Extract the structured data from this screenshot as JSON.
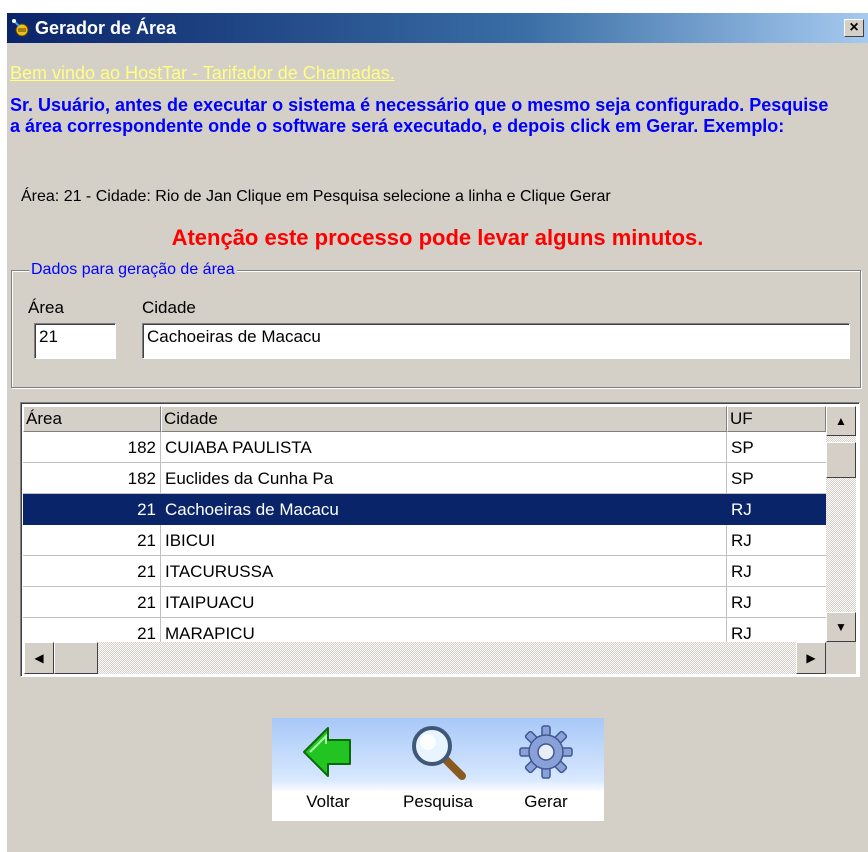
{
  "window": {
    "title": "Gerador de Área",
    "close_label": "×"
  },
  "welcome": "Bem vindo ao HostTar - Tarifador de Chamadas.",
  "instructions": "Sr. Usuário, antes de executar o sistema é necessário que o mesmo seja configurado. Pesquise a área correspondente onde o software será executado, e depois click em Gerar. Exemplo:",
  "example": "Área: 21 -  Cidade: Rio de Jan Clique em Pesquisa selecione a linha e Clique Gerar",
  "warning": "Atenção este processo pode levar alguns minutos.",
  "form": {
    "legend": "Dados para geração de área",
    "area_label": "Área",
    "city_label": "Cidade",
    "area_value": "21",
    "city_value": "Cachoeiras de Macacu"
  },
  "grid": {
    "headers": [
      "Área",
      "Cidade",
      "UF"
    ],
    "rows": [
      {
        "area": "182",
        "city": "CUIABA PAULISTA",
        "uf": "SP"
      },
      {
        "area": "182",
        "city": "Euclides da Cunha Pa",
        "uf": "SP"
      },
      {
        "area": "21",
        "city": "Cachoeiras de Macacu",
        "uf": "RJ"
      },
      {
        "area": "21",
        "city": "IBICUI",
        "uf": "RJ"
      },
      {
        "area": "21",
        "city": "ITACURUSSA",
        "uf": "RJ"
      },
      {
        "area": "21",
        "city": "ITAIPUACU",
        "uf": "RJ"
      },
      {
        "area": "21",
        "city": "MARAPICU",
        "uf": "RJ"
      }
    ],
    "selected_index": 2
  },
  "toolbar": {
    "back_label": "Voltar",
    "search_label": "Pesquisa",
    "generate_label": "Gerar"
  },
  "icons": {
    "back": "arrow-left-icon",
    "search": "magnifier-icon",
    "generate": "gear-icon"
  },
  "colors": {
    "title_bar": "#0a246a",
    "welcome": "#ffff80",
    "instructions": "#0000ff",
    "warning": "#ff0000",
    "selection": "#0a246a"
  }
}
